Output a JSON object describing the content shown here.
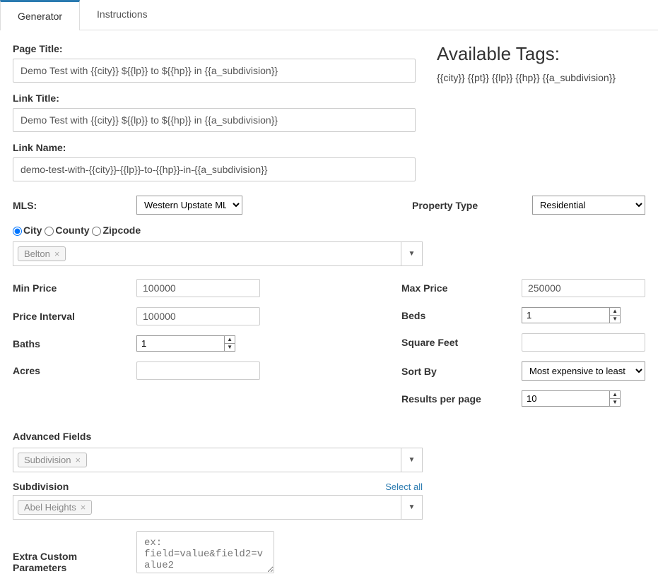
{
  "tabs": {
    "generator": "Generator",
    "instructions": "Instructions"
  },
  "labels": {
    "page_title": "Page Title:",
    "link_title": "Link Title:",
    "link_name": "Link Name:",
    "mls": "MLS:",
    "property_type": "Property Type",
    "min_price": "Min Price",
    "max_price": "Max Price",
    "price_interval": "Price Interval",
    "beds": "Beds",
    "baths": "Baths",
    "square_feet": "Square Feet",
    "acres": "Acres",
    "sort_by": "Sort By",
    "results_per_page": "Results per page",
    "advanced_fields": "Advanced Fields",
    "subdivision": "Subdivision",
    "select_all": "Select all",
    "extra_params": "Extra Custom Parameters"
  },
  "radios": {
    "city": "City",
    "county": "County",
    "zipcode": "Zipcode"
  },
  "values": {
    "page_title": "Demo Test with {{city}} ${{lp}} to ${{hp}} in {{a_subdivision}}",
    "link_title": "Demo Test with {{city}} ${{lp}} to ${{hp}} in {{a_subdivision}}",
    "link_name": "demo-test-with-{{city}}-{{lp}}-to-{{hp}}-in-{{a_subdivision}}",
    "mls": "Western Upstate MLS",
    "property_type": "Residential",
    "geo_token": "Belton",
    "min_price": "100000",
    "max_price": "250000",
    "price_interval": "100000",
    "beds": "1",
    "baths": "1",
    "square_feet": "",
    "acres": "",
    "sort_by": "Most expensive to least",
    "results_per_page": "10",
    "adv_field_token": "Subdivision",
    "subdivision_token": "Abel Heights",
    "extra_params_placeholder": "ex: field=value&field2=value2"
  },
  "available": {
    "heading": "Available Tags:",
    "tags": "{{city}} {{pt}} {{lp}} {{hp}} {{a_subdivision}}"
  }
}
